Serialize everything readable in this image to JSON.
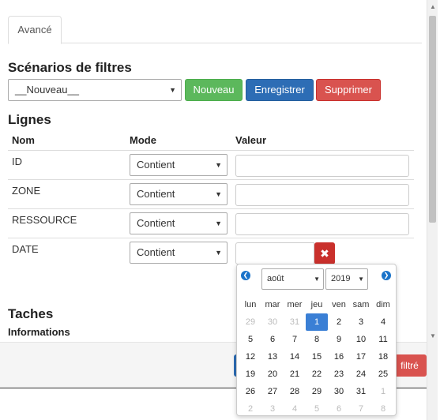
{
  "tabs": [
    {
      "label": "Avancé"
    }
  ],
  "scenarios": {
    "title": "Scénarios de filtres",
    "select_value": "__Nouveau__",
    "buttons": {
      "new": "Nouveau",
      "save": "Enregistrer",
      "delete": "Supprimer"
    }
  },
  "lines": {
    "title": "Lignes",
    "headers": {
      "name": "Nom",
      "mode": "Mode",
      "value": "Valeur"
    },
    "rows": [
      {
        "name": "ID",
        "mode": "Contient",
        "value": ""
      },
      {
        "name": "ZONE",
        "mode": "Contient",
        "value": ""
      },
      {
        "name": "RESSOURCE",
        "mode": "Contient",
        "value": ""
      },
      {
        "name": "DATE",
        "mode": "Contient",
        "value": ""
      }
    ]
  },
  "tasks": {
    "title": "Taches",
    "subtitle": "Informations"
  },
  "footer": {
    "filter_button_fragment": "filtré"
  },
  "datepicker": {
    "month": "août",
    "year": "2019",
    "weekdays": [
      "lun",
      "mar",
      "mer",
      "jeu",
      "ven",
      "sam",
      "dim"
    ],
    "weeks": [
      [
        "29",
        "30",
        "31",
        "1",
        "2",
        "3",
        "4"
      ],
      [
        "5",
        "6",
        "7",
        "8",
        "9",
        "10",
        "11"
      ],
      [
        "12",
        "13",
        "14",
        "15",
        "16",
        "17",
        "18"
      ],
      [
        "19",
        "20",
        "21",
        "22",
        "23",
        "24",
        "25"
      ],
      [
        "26",
        "27",
        "28",
        "29",
        "30",
        "31",
        "1"
      ],
      [
        "2",
        "3",
        "4",
        "5",
        "6",
        "7",
        "8"
      ]
    ],
    "other_month": [
      [
        true,
        true,
        true,
        false,
        false,
        false,
        false
      ],
      [
        false,
        false,
        false,
        false,
        false,
        false,
        false
      ],
      [
        false,
        false,
        false,
        false,
        false,
        false,
        false
      ],
      [
        false,
        false,
        false,
        false,
        false,
        false,
        false
      ],
      [
        false,
        false,
        false,
        false,
        false,
        false,
        true
      ],
      [
        true,
        true,
        true,
        true,
        true,
        true,
        true
      ]
    ],
    "selected": {
      "week": 0,
      "day": 3
    },
    "accent": "#3a7fd5"
  },
  "colors": {
    "success": "#5cb85c",
    "primary": "#2d6db5",
    "danger": "#d9534f"
  }
}
